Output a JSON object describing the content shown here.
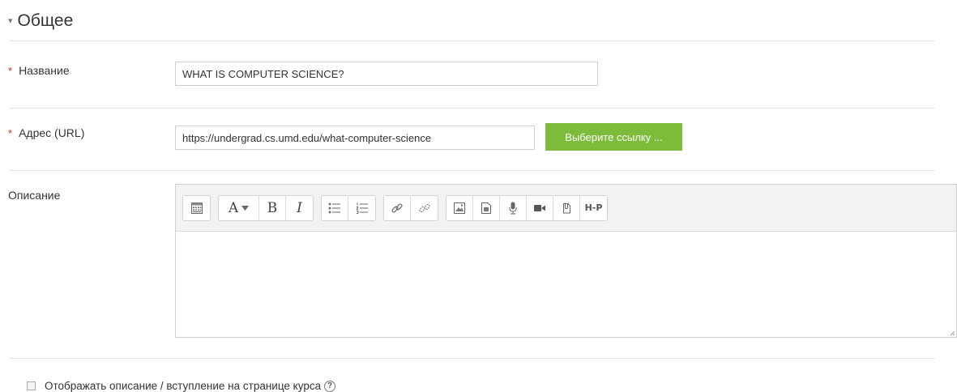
{
  "section": {
    "title": "Общее",
    "caret": "▾"
  },
  "required_marker": "*",
  "fields": {
    "name": {
      "label": "Название",
      "value": "WHAT IS COMPUTER SCIENCE?"
    },
    "url": {
      "label": "Адрес (URL)",
      "value": "https://undergrad.cs.umd.edu/what-computer-science",
      "button": "Выберите ссылку ..."
    },
    "description": {
      "label": "Описание"
    }
  },
  "toolbar": {
    "font_letter": "A",
    "bold": "B",
    "italic": "I",
    "h5p": "H-P"
  },
  "display_description": {
    "label": "Отображать описание / вступление на странице курса",
    "help": "?"
  },
  "colors": {
    "accent_green": "#7dbb3a",
    "required_red": "#ca3120"
  }
}
